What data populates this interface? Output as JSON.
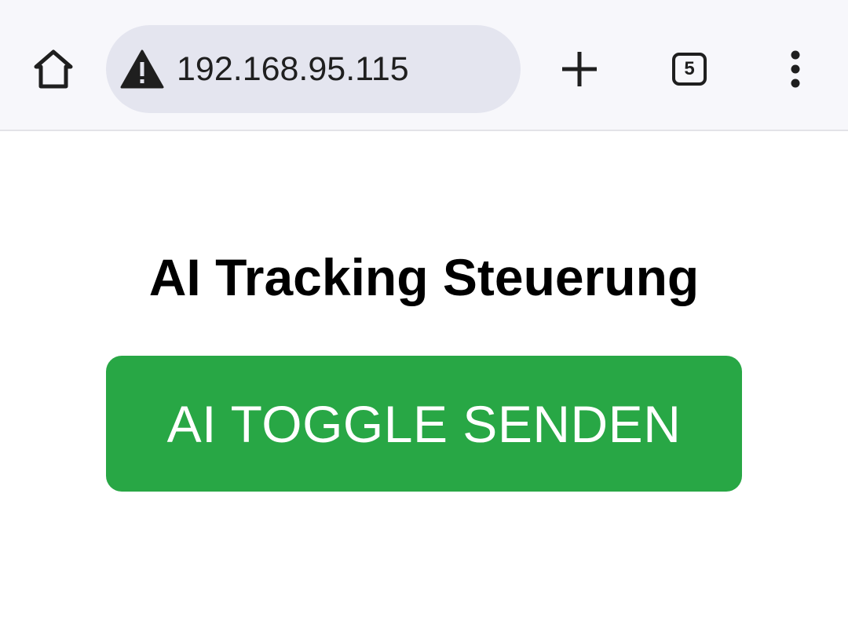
{
  "browser": {
    "url": "192.168.95.115",
    "tab_count": "5",
    "icons": {
      "home": "home-icon",
      "security": "warning-triangle-icon",
      "new_tab": "plus-icon",
      "tabs": "tab-switcher-icon",
      "menu": "more-vert-icon"
    }
  },
  "page": {
    "title": "AI Tracking Steuerung",
    "toggle_button_label": "AI TOGGLE SENDEN"
  },
  "colors": {
    "toolbar_bg": "#f7f7fb",
    "omnibox_bg": "#e4e5ef",
    "button_green": "#28a745",
    "button_text": "#ffffff"
  }
}
